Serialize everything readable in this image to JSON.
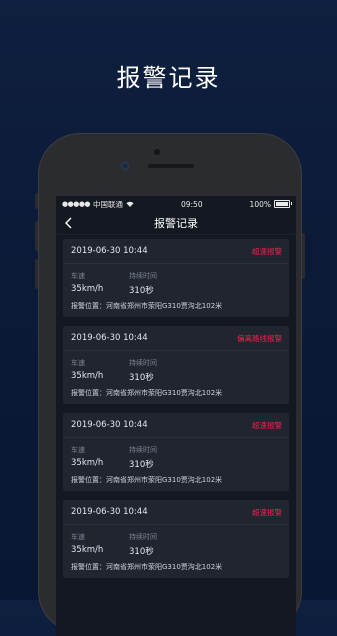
{
  "promo_title": "报警记录",
  "status_bar": {
    "carrier": "中国联通",
    "time": "09:50",
    "battery": "100%"
  },
  "nav": {
    "title": "报警记录"
  },
  "records": [
    {
      "time": "2019-06-30 10:44",
      "type": "超速报警",
      "speed_label": "车速",
      "speed": "35km/h",
      "duration_label": "持续时间",
      "duration": "310秒",
      "location": "报警位置：河南省郑州市荥阳G310贾沟北102米"
    },
    {
      "time": "2019-06-30 10:44",
      "type": "偏离路线报警",
      "speed_label": "车速",
      "speed": "35km/h",
      "duration_label": "持续时间",
      "duration": "310秒",
      "location": "报警位置：河南省郑州市荥阳G310贾沟北102米"
    },
    {
      "time": "2019-06-30 10:44",
      "type": "超速报警",
      "speed_label": "车速",
      "speed": "35km/h",
      "duration_label": "持续时间",
      "duration": "310秒",
      "location": "报警位置：河南省郑州市荥阳G310贾沟北102米"
    },
    {
      "time": "2019-06-30 10:44",
      "type": "超速报警",
      "speed_label": "车速",
      "speed": "35km/h",
      "duration_label": "持续时间",
      "duration": "310秒",
      "location": "报警位置：河南省郑州市荥阳G310贾沟北102米"
    }
  ],
  "colors": {
    "alarm": "#e8254c",
    "background": "#0f1f3f",
    "card": "#21252f"
  }
}
